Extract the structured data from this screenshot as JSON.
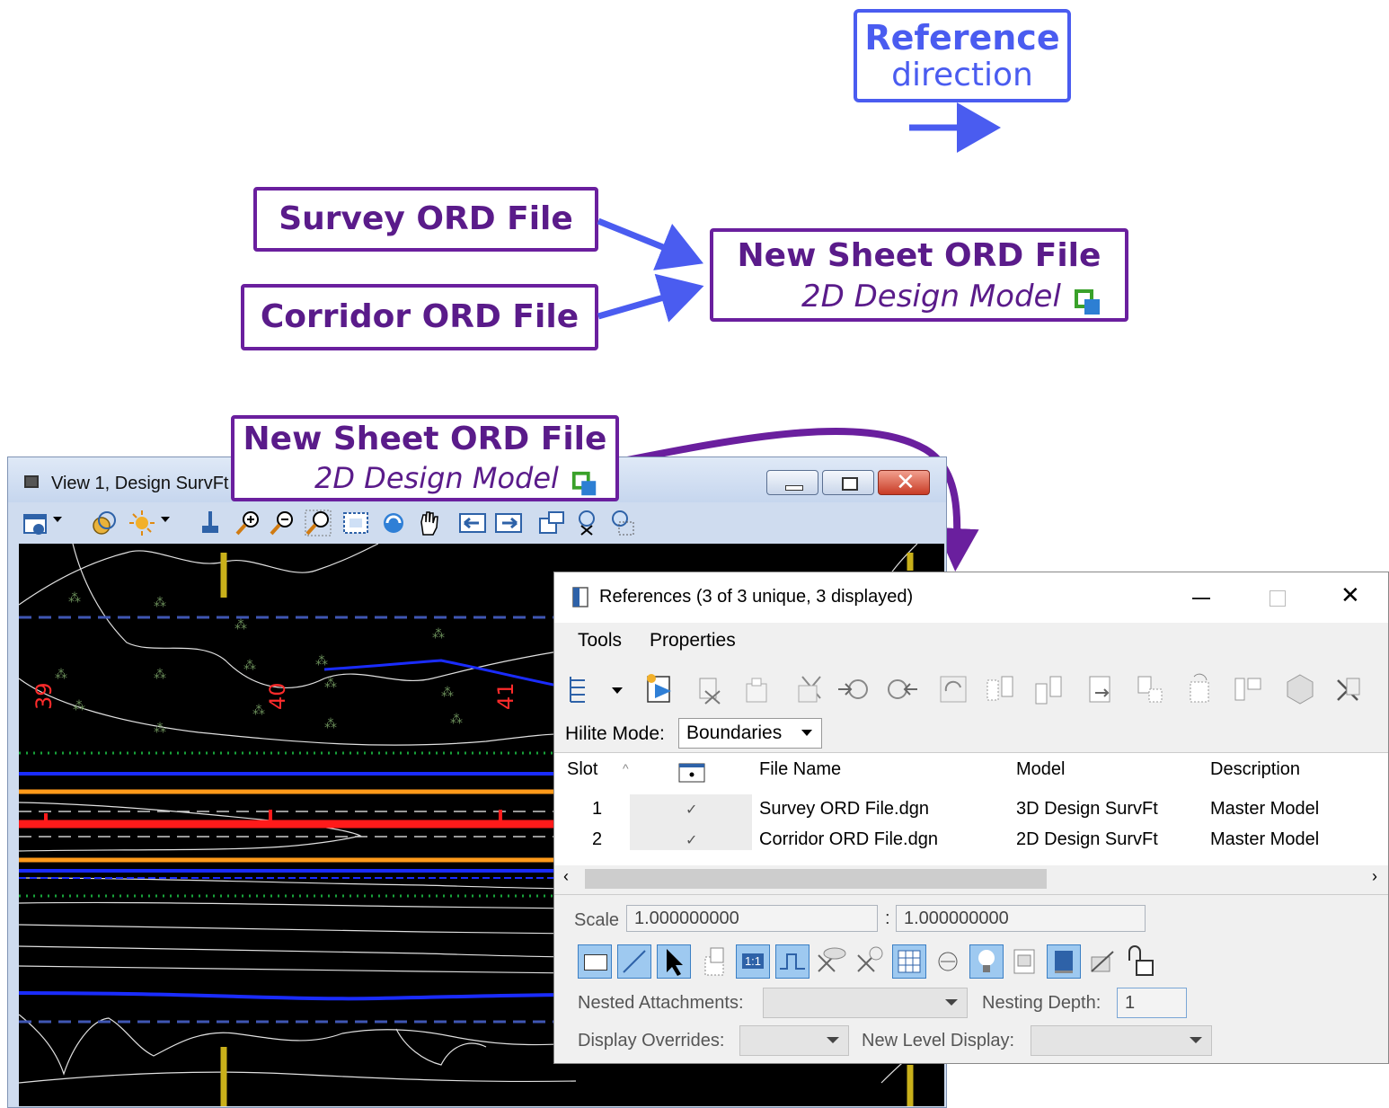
{
  "callouts": {
    "reference_direction": {
      "bold": "Reference",
      "normal": "direction"
    },
    "survey": "Survey ORD File",
    "corridor": "Corridor ORD File",
    "new_sheet_top": {
      "title": "New Sheet ORD File",
      "subtitle": "2D Design Model"
    },
    "new_sheet_bottom": {
      "title": "New Sheet ORD File",
      "subtitle": "2D Design Model"
    }
  },
  "colors": {
    "arrow_blue": "#4a5cf0",
    "callout_purple": "#6a1f9e",
    "arrow_purple": "#6a1f9e"
  },
  "cad_window": {
    "title": "View 1, Design SurvFt",
    "toolbar_icons": [
      "view-attributes-icon",
      "display-style-icon",
      "lighting-icon",
      "update-view-icon",
      "zoom-in-icon",
      "zoom-out-icon",
      "window-area-icon",
      "fit-view-icon",
      "rotate-view-icon",
      "pan-view-icon",
      "previous-view-icon",
      "next-view-icon",
      "copy-view-icon",
      "clip-volume-icon",
      "clip-mask-icon"
    ],
    "station_labels": [
      "39",
      "40",
      "41"
    ]
  },
  "references": {
    "title": "References (3 of 3 unique, 3 displayed)",
    "menu": [
      "Tools",
      "Properties"
    ],
    "hilite_label": "Hilite Mode:",
    "hilite_value": "Boundaries",
    "columns": {
      "slot": "Slot",
      "file_name": "File Name",
      "model": "Model",
      "description": "Description"
    },
    "rows": [
      {
        "slot": "1",
        "check": "✓",
        "file_name": "Survey ORD File.dgn",
        "model": "3D Design SurvFt",
        "description": "Master Model"
      },
      {
        "slot": "2",
        "check": "✓",
        "file_name": "Corridor ORD File.dgn",
        "model": "2D Design SurvFt",
        "description": "Master Model"
      }
    ],
    "scale_label": "Scale",
    "scale_value_1": "1.000000000",
    "scale_separator": ":",
    "scale_value_2": "1.000000000",
    "nested_label": "Nested Attachments:",
    "nesting_depth_label": "Nesting Depth:",
    "nesting_depth_value": "1",
    "display_overrides_label": "Display Overrides:",
    "new_level_display_label": "New Level Display:"
  }
}
